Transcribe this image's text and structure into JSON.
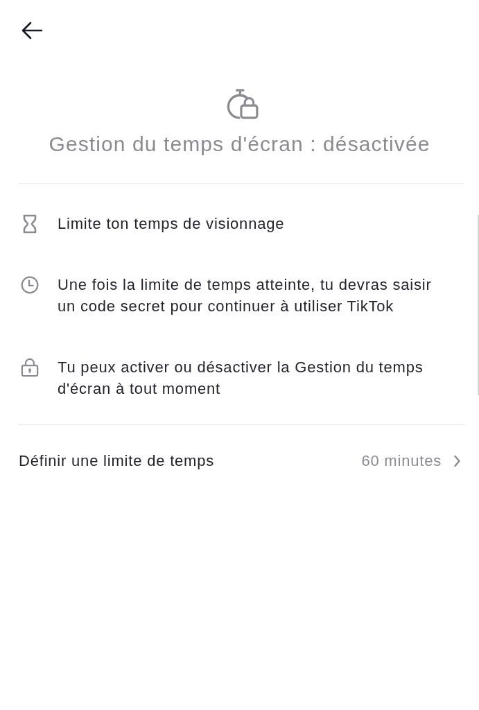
{
  "header": {
    "status_title": "Gestion du temps d'écran : désactivée"
  },
  "features": [
    {
      "text": "Limite ton temps de visionnage"
    },
    {
      "text": "Une fois la limite de temps atteinte, tu devras saisir un code secret pour continuer à utiliser TikTok"
    },
    {
      "text": "Tu peux activer ou désactiver la Gestion du temps d'écran à tout moment"
    }
  ],
  "setting": {
    "label": "Définir une limite de temps",
    "value": "60 minutes"
  }
}
